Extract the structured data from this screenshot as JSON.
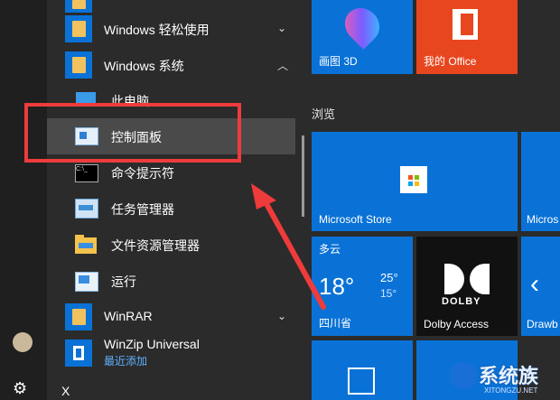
{
  "start_list": {
    "items": [
      {
        "label": "Windows 轻松使用",
        "type": "folder"
      },
      {
        "label": "Windows 系统",
        "type": "folder-open"
      },
      {
        "label": "此电脑",
        "type": "app"
      },
      {
        "label": "控制面板",
        "type": "app",
        "highlighted": true
      },
      {
        "label": "命令提示符",
        "type": "app"
      },
      {
        "label": "任务管理器",
        "type": "app"
      },
      {
        "label": "文件资源管理器",
        "type": "app"
      },
      {
        "label": "运行",
        "type": "app"
      },
      {
        "label": "WinRAR",
        "type": "folder"
      },
      {
        "label": "WinZip Universal",
        "sublabel": "最近添加",
        "type": "app"
      }
    ]
  },
  "left_rail": {
    "user_icon": "user-avatar-icon",
    "settings_icon": "gear-icon",
    "letter": "X"
  },
  "tiles": {
    "group_title": "浏览",
    "paint3d": "画图 3D",
    "office": "我的 Office",
    "store": "Microsoft Store",
    "store_partial": "Micros",
    "weather": {
      "condition": "多云",
      "temp": "18°",
      "high": "25°",
      "low": "15°",
      "location": "四川省"
    },
    "dolby_logo": "DOLBY",
    "dolby": "Dolby Access",
    "drawboard": "Drawb"
  },
  "annotation": {
    "color": "#ef3b3b"
  },
  "watermark": {
    "text": "系统族",
    "sub": "XITONGZU.NET"
  }
}
